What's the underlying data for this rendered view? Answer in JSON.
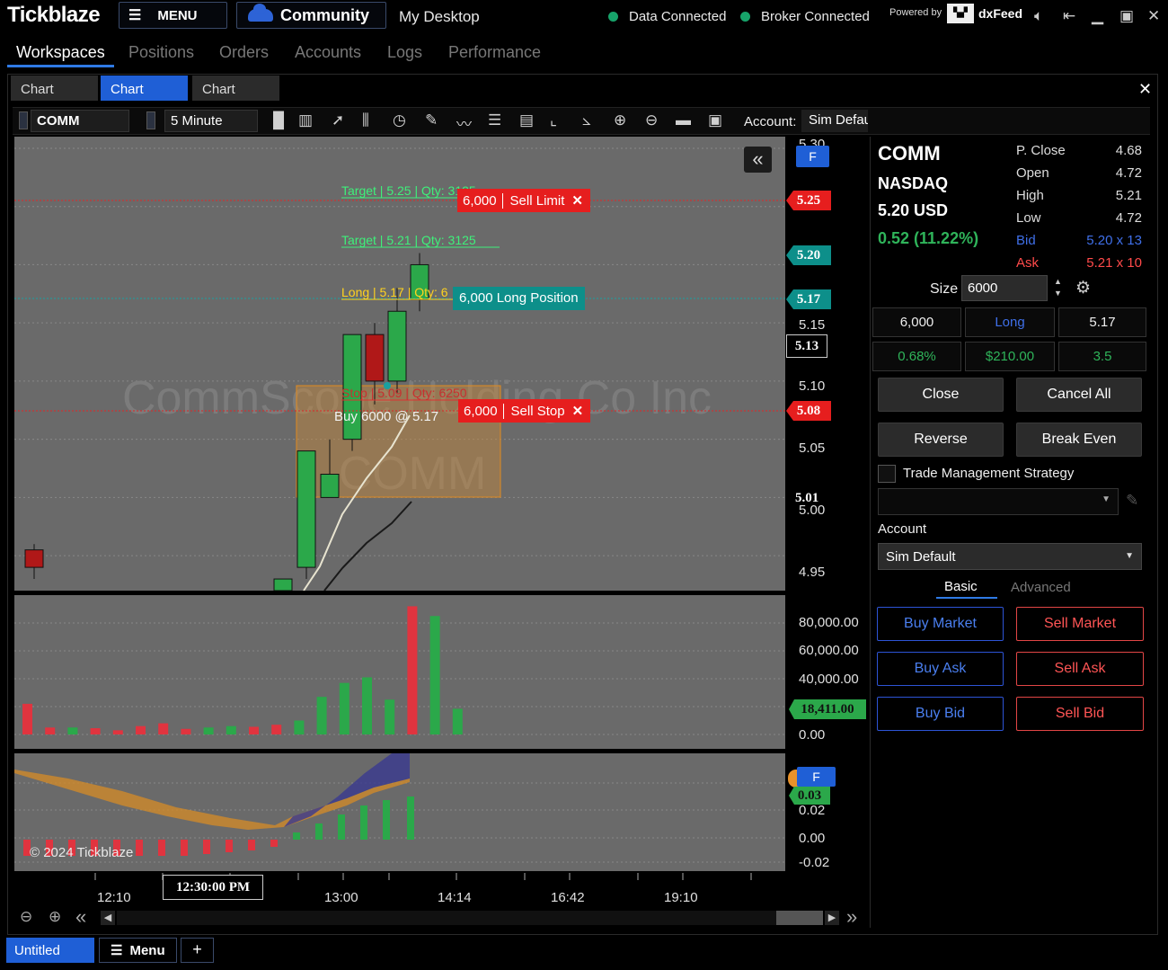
{
  "app": {
    "title": "Tickblaze",
    "menu_label": "MENU",
    "community_label": "Community",
    "desktop_label": "My Desktop",
    "data_status": "Data Connected",
    "broker_status": "Broker Connected",
    "powered_by": "Powered by",
    "provider": "dxFeed",
    "status_color": "#17a36a"
  },
  "nav": {
    "tabs": [
      "Workspaces",
      "Positions",
      "Orders",
      "Accounts",
      "Logs",
      "Performance"
    ],
    "active": "Workspaces"
  },
  "chart_tabs": [
    "Chart",
    "Chart",
    "Chart"
  ],
  "toolbar": {
    "symbol": "COMM",
    "timeframe": "5 Minute",
    "account_label": "Account:",
    "account_value": "Sim Default"
  },
  "chart": {
    "watermark_symbol": "COMM",
    "watermark_name": "CommScope Holding Co Inc",
    "copyright": "© 2024 Tickblaze",
    "f_badge": "F",
    "price_axis": [
      "5.30",
      "5.25",
      "5.20",
      "5.17",
      "5.15",
      "5.13",
      "5.10",
      "5.08",
      "5.05",
      "5.01",
      "5.00",
      "4.95"
    ],
    "price_labels": {
      "sell_limit": "5.25",
      "last": "5.20",
      "position": "5.17",
      "crosshair": "5.13",
      "sell_stop": "5.08",
      "box_low": "5.01"
    },
    "orders": {
      "target1": "Target | 5.25 | Qty: 3125",
      "target2": "Target | 5.21 | Qty: 3125",
      "long": "Long | 5.17 | Qty: 6",
      "stop": "Stop | 5.09 | Qty: 6250",
      "sell_limit_qty": "6,000",
      "sell_limit_label": "Sell Limit",
      "position_label": "6,000 Long Position",
      "sell_stop_qty": "6,000",
      "sell_stop_label": "Sell Stop",
      "buy_note": "Buy 6000 @ 5.17"
    },
    "volume_axis": [
      "80,000.00",
      "60,000.00",
      "40,000.00",
      "18,411.00",
      "0.00"
    ],
    "osc_axis": [
      "0.03",
      "0.02",
      "0.00",
      "-0.02"
    ],
    "time_axis": [
      "12:10",
      "12:30:00 PM",
      "13:00",
      "14:14",
      "16:42",
      "19:10"
    ]
  },
  "chart_data": {
    "type": "bar",
    "title": "COMM",
    "candles": [
      {
        "o": 4.955,
        "h": 4.96,
        "l": 4.93,
        "c": 4.94
      },
      {
        "o": 4.92,
        "h": 4.93,
        "l": 4.91,
        "c": 4.93
      },
      {
        "o": 4.94,
        "h": 5.04,
        "l": 4.93,
        "c": 5.04
      },
      {
        "o": 5.0,
        "h": 5.05,
        "l": 5.0,
        "c": 5.02
      },
      {
        "o": 5.05,
        "h": 5.14,
        "l": 5.04,
        "c": 5.14
      },
      {
        "o": 5.14,
        "h": 5.15,
        "l": 5.08,
        "c": 5.1
      },
      {
        "o": 5.1,
        "h": 5.18,
        "l": 5.09,
        "c": 5.16
      },
      {
        "o": 5.17,
        "h": 5.21,
        "l": 5.16,
        "c": 5.2
      }
    ],
    "volume": [
      {
        "v": 22000,
        "up": false
      },
      {
        "v": 5000,
        "up": false
      },
      {
        "v": 5000,
        "up": true
      },
      {
        "v": 4500,
        "up": false
      },
      {
        "v": 3000,
        "up": false
      },
      {
        "v": 6000,
        "up": false
      },
      {
        "v": 8000,
        "up": false
      },
      {
        "v": 4000,
        "up": false
      },
      {
        "v": 5000,
        "up": true
      },
      {
        "v": 6000,
        "up": true
      },
      {
        "v": 5500,
        "up": false
      },
      {
        "v": 7000,
        "up": false
      },
      {
        "v": 10000,
        "up": true
      },
      {
        "v": 27000,
        "up": true
      },
      {
        "v": 37000,
        "up": true
      },
      {
        "v": 41000,
        "up": true
      },
      {
        "v": 25000,
        "up": true
      },
      {
        "v": 92000,
        "up": false
      },
      {
        "v": 85000,
        "up": true
      },
      {
        "v": 18411,
        "up": true
      }
    ],
    "ylim": [
      4.92,
      5.31
    ],
    "vol_ylim": [
      0,
      100000
    ],
    "colors": {
      "up": "#2ba84a",
      "down": "#e0343f",
      "bg": "#6a6a6a"
    }
  },
  "panel": {
    "symbol": "COMM",
    "exchange": "NASDAQ",
    "price": "5.20 USD",
    "change": "0.52 (11.22%)",
    "quotes": [
      {
        "label": "P. Close",
        "value": "4.68"
      },
      {
        "label": "Open",
        "value": "4.72"
      },
      {
        "label": "High",
        "value": "5.21"
      },
      {
        "label": "Low",
        "value": "4.72"
      },
      {
        "label": "Bid",
        "value": "5.20 x 13"
      },
      {
        "label": "Ask",
        "value": "5.21 x 10"
      }
    ],
    "size_label": "Size",
    "size_value": "6000",
    "position": [
      "6,000",
      "Long",
      "5.17"
    ],
    "pnl": [
      "0.68%",
      "$210.00",
      "3.5"
    ],
    "close": "Close",
    "cancel_all": "Cancel All",
    "reverse": "Reverse",
    "break_even": "Break Even",
    "tms_label": "Trade Management Strategy",
    "account_label": "Account",
    "account_value": "Sim Default",
    "tabs": [
      "Basic",
      "Advanced"
    ],
    "buy_market": "Buy Market",
    "sell_market": "Sell Market",
    "buy_ask": "Buy Ask",
    "sell_ask": "Sell Ask",
    "buy_bid": "Buy Bid",
    "sell_bid": "Sell Bid"
  },
  "bottom": {
    "tab": "Untitled",
    "menu": "Menu",
    "add": "+"
  }
}
